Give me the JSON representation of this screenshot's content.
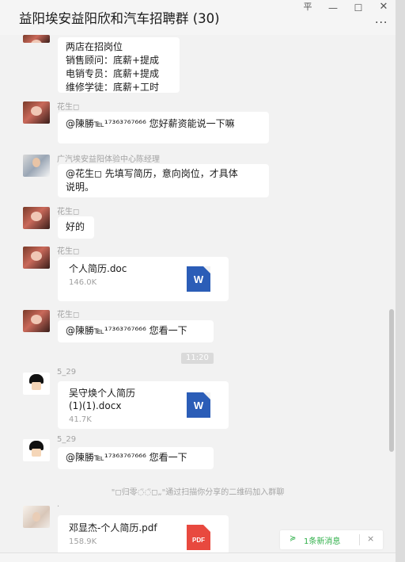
{
  "window": {
    "title": "益阳埃安益阳欣和汽车招聘群 (30)",
    "pin_glyph": "平",
    "minimize_glyph": "—",
    "maximize_glyph": "☐",
    "close_glyph": "✕",
    "more_glyph": "..."
  },
  "messages": {
    "m1": {
      "lines": [
        "两店在招岗位",
        "销售顾问：底薪+提成",
        "电销专员：底薪+提成",
        "维修学徒：底薪+工时"
      ]
    },
    "m2": {
      "sender": "花生◻",
      "text": "@陳勝℡¹⁷³⁶³⁷⁶⁷⁶⁶⁶ 您好薪资能说一下嘛"
    },
    "m3": {
      "sender": "广汽埃安益阳体验中心陈经理",
      "lines": [
        "@花生◻ 先填写简历，意向岗位，才具体",
        "说明。"
      ]
    },
    "m4": {
      "sender": "花生◻",
      "text": "好的"
    },
    "m5": {
      "sender": "花生◻",
      "file_name": "个人简历.doc",
      "file_size": "146.0K",
      "file_icon": "W"
    },
    "m6": {
      "sender": "花生◻",
      "text": "@陳勝℡¹⁷³⁶³⁷⁶⁷⁶⁶⁶ 您看一下"
    },
    "timestamp": "11:20",
    "m7": {
      "sender": "5_29",
      "file_lines": [
        "吴守焕个人简历",
        "(1)(1).docx"
      ],
      "file_size": "41.7K",
      "file_icon": "W"
    },
    "m8": {
      "sender": "5_29",
      "text": "@陳勝℡¹⁷³⁶³⁷⁶⁷⁶⁶⁶ 您看一下"
    },
    "system": "\"◻归零◌̈◌̈◻„\"通过扫描你分享的二维码加入群聊",
    "m9": {
      "sender": ".",
      "file_name": "邓显杰-个人简历.pdf",
      "file_size": "158.9K",
      "file_icon": "PDF"
    }
  },
  "new_message_bar": {
    "arrow": "≽",
    "label": "1条新消息",
    "close": "×"
  },
  "colors": {
    "background": "#f2f2f2",
    "bubble": "#ffffff",
    "word_blue": "#2b5db7",
    "pdf_red": "#e8493f",
    "accent_green": "#30b04a"
  }
}
